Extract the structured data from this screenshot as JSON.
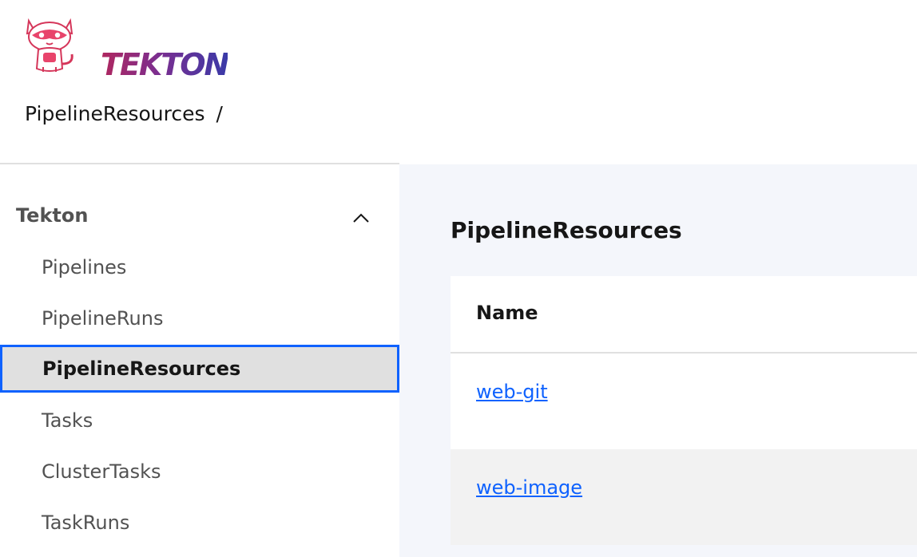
{
  "brand": {
    "logo_text": "TEKTON"
  },
  "breadcrumb": {
    "current": "PipelineResources",
    "separator": "/"
  },
  "sidebar": {
    "section_title": "Tekton",
    "items": [
      {
        "label": "Pipelines"
      },
      {
        "label": "PipelineRuns"
      },
      {
        "label": "PipelineResources"
      },
      {
        "label": "Tasks"
      },
      {
        "label": "ClusterTasks"
      },
      {
        "label": "TaskRuns"
      }
    ]
  },
  "main": {
    "title": "PipelineResources",
    "table": {
      "columns": [
        "Name"
      ],
      "rows": [
        {
          "name": "web-git"
        },
        {
          "name": "web-image"
        }
      ]
    }
  },
  "colors": {
    "accent": "#0f62fe",
    "sidebar_active_bg": "#e0e0e0",
    "main_bg": "#f4f6fb"
  }
}
